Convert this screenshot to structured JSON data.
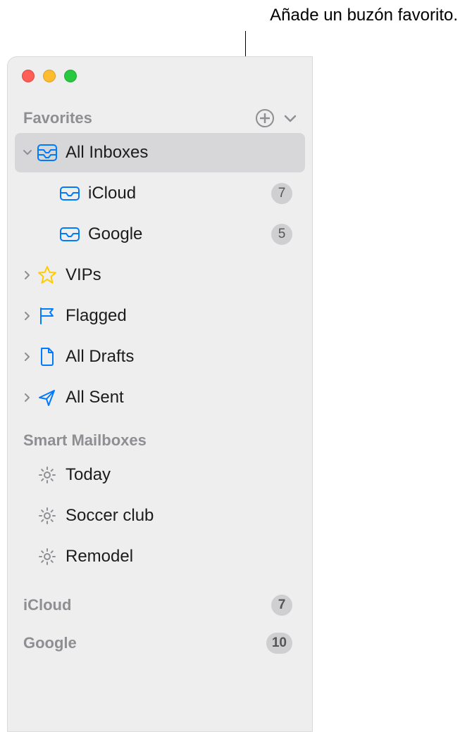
{
  "callout": "Añade un buzón favorito.",
  "sections": {
    "favorites": {
      "title": "Favorites",
      "items": {
        "all_inboxes": "All Inboxes",
        "icloud": {
          "label": "iCloud",
          "badge": "7"
        },
        "google": {
          "label": "Google",
          "badge": "5"
        },
        "vips": "VIPs",
        "flagged": "Flagged",
        "all_drafts": "All Drafts",
        "all_sent": "All Sent"
      }
    },
    "smart": {
      "title": "Smart Mailboxes",
      "items": {
        "today": "Today",
        "soccer": "Soccer club",
        "remodel": "Remodel"
      }
    }
  },
  "accounts": {
    "icloud": {
      "label": "iCloud",
      "badge": "7"
    },
    "google": {
      "label": "Google",
      "badge": "10"
    }
  }
}
